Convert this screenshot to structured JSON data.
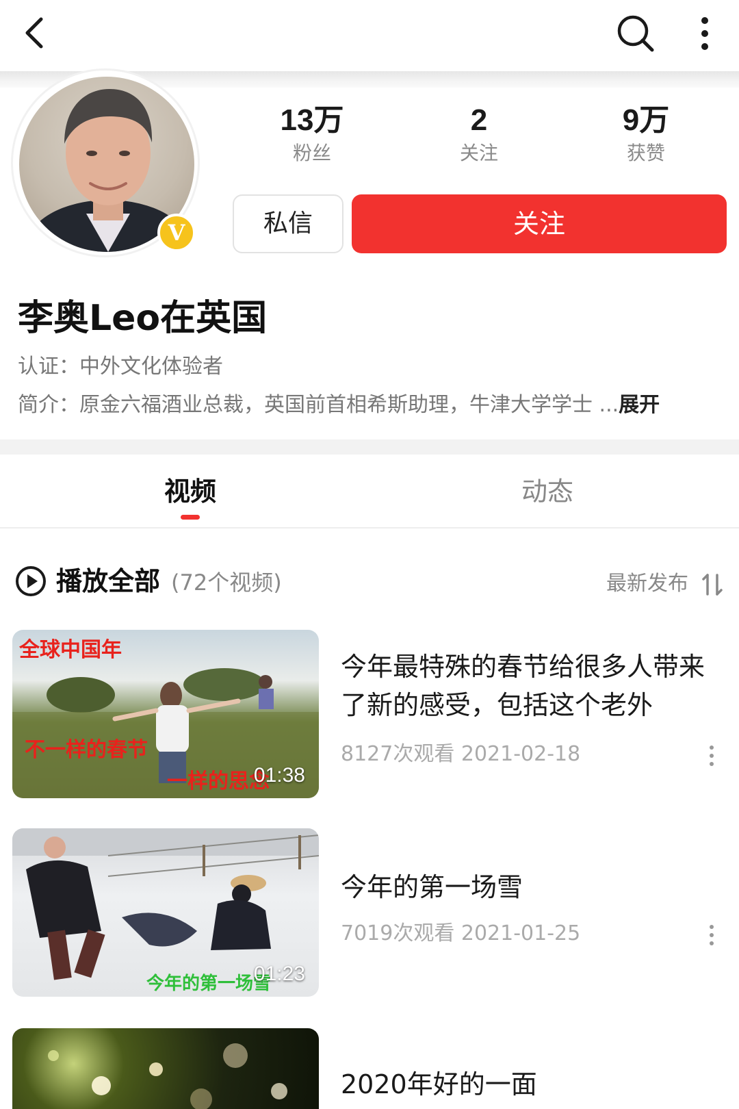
{
  "profile": {
    "name": "李奥Leo在英国",
    "certification": "认证：中外文化体验者",
    "bio": "简介：原金六福酒业总裁，英国前首相希斯助理，牛津大学学士 ...",
    "bio_expand": "展开",
    "verified_badge": "V",
    "stats": [
      {
        "value": "13万",
        "label": "粉丝"
      },
      {
        "value": "2",
        "label": "关注"
      },
      {
        "value": "9万",
        "label": "获赞"
      }
    ],
    "message_button": "私信",
    "follow_button": "关注"
  },
  "tabs": [
    {
      "label": "视频",
      "active": true
    },
    {
      "label": "动态",
      "active": false
    }
  ],
  "list_header": {
    "play_all": "播放全部",
    "video_count": "(72个视频)",
    "sort": "最新发布"
  },
  "videos": [
    {
      "title": "今年最特殊的春节给很多人带来了新的感受，包括这个老外",
      "meta": "8127次观看  2021-02-18",
      "duration": "01:38",
      "overlay_texts": [
        "全球中国年",
        "不一样的春节",
        "一样的思念"
      ]
    },
    {
      "title": "今年的第一场雪",
      "meta": "7019次观看  2021-01-25",
      "duration": "01:23",
      "overlay_texts": [
        "今年的第一场雪"
      ]
    },
    {
      "title": "2020年好的一面",
      "meta": "",
      "duration": "",
      "overlay_texts": []
    }
  ],
  "icons": {
    "back": "chevron-left-icon",
    "search": "search-icon",
    "more": "more-vertical-icon",
    "play_all": "play-circle-icon",
    "sort": "sort-icon"
  },
  "colors": {
    "accent": "#f2322f",
    "badge": "#f6c31c"
  }
}
